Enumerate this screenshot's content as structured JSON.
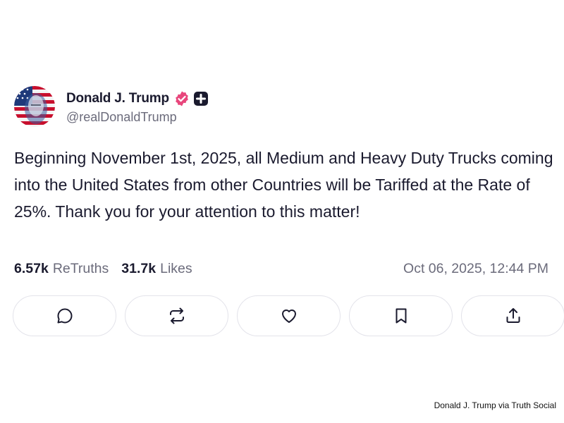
{
  "post": {
    "author_name": "Donald J. Trump",
    "handle": "@realDonaldTrump",
    "body": "Beginning November 1st, 2025, all Medium and Heavy Duty Trucks coming into the United States from other Countries will be Tariffed at the Rate of 25%. Thank you for your attention to this matter!",
    "retruths_count": "6.57k",
    "retruths_label": "ReTruths",
    "likes_count": "31.7k",
    "likes_label": "Likes",
    "timestamp": "Oct 06, 2025, 12:44 PM"
  },
  "actions": [
    {
      "name": "reply",
      "icon": "chat-bubble-icon"
    },
    {
      "name": "retruth",
      "icon": "repost-arrows-icon"
    },
    {
      "name": "like",
      "icon": "heart-icon"
    },
    {
      "name": "bookmark",
      "icon": "bookmark-icon"
    },
    {
      "name": "share",
      "icon": "share-upload-icon"
    }
  ],
  "credit": "Donald J. Trump via Truth Social",
  "colors": {
    "text": "#1a1a2e",
    "muted": "#6b6b7b",
    "verified_badge": "#e8467c",
    "border": "#e3e3ea"
  }
}
